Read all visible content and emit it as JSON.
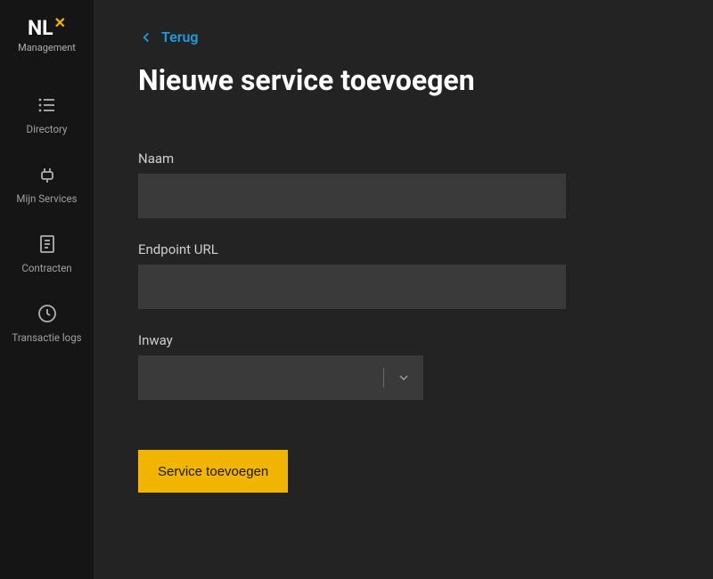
{
  "brand": {
    "name_part1": "NL",
    "name_part2": "✕",
    "subtitle": "Management"
  },
  "sidebar": {
    "items": [
      {
        "label": "Directory"
      },
      {
        "label": "Mijn Services"
      },
      {
        "label": "Contracten"
      },
      {
        "label": "Transactie logs"
      }
    ]
  },
  "back": {
    "label": "Terug"
  },
  "page": {
    "title": "Nieuwe service toevoegen"
  },
  "form": {
    "name": {
      "label": "Naam",
      "value": ""
    },
    "endpoint_url": {
      "label": "Endpoint URL",
      "value": ""
    },
    "inway": {
      "label": "Inway",
      "selected": ""
    },
    "submit_label": "Service toevoegen"
  },
  "colors": {
    "accent": "#f1b400",
    "link": "#1f9bd8",
    "bg_main": "#232323",
    "bg_sidebar": "#151515",
    "bg_input": "#3a3a3a"
  }
}
